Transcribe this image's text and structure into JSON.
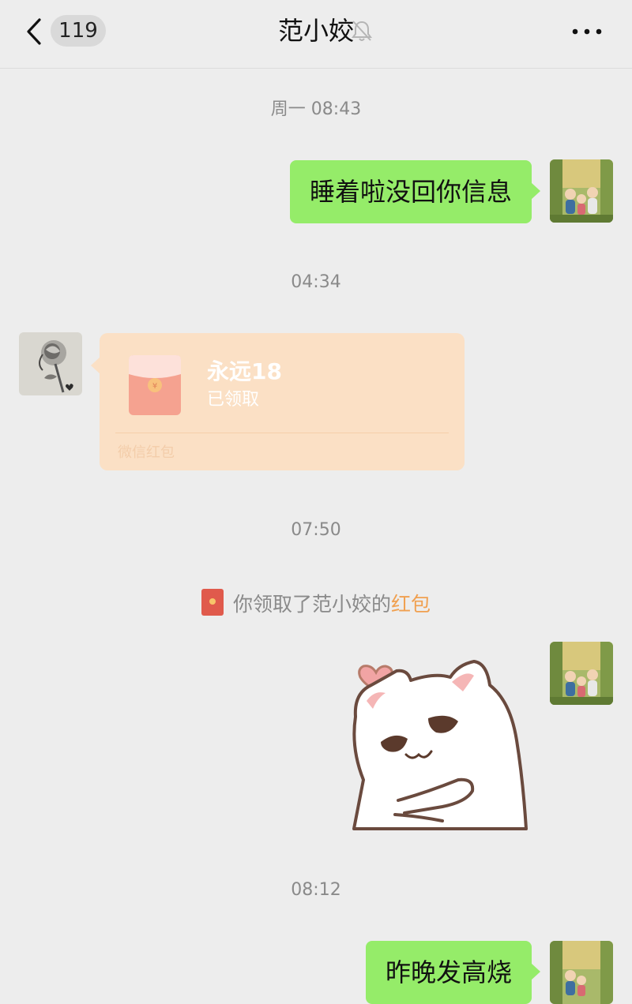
{
  "header": {
    "unread_count": "119",
    "title": "范小姣",
    "icons": [
      "back-chevron-icon",
      "mute-bell-icon",
      "more-dots-icon"
    ]
  },
  "messages": [
    {
      "type": "timestamp",
      "text": "周一 08:43"
    },
    {
      "type": "text",
      "side": "right",
      "text": "睡着啦没回你信息"
    },
    {
      "type": "timestamp",
      "text": "04:34"
    },
    {
      "type": "red_packet",
      "side": "left",
      "title": "永远18",
      "status": "已领取",
      "footer": "微信红包"
    },
    {
      "type": "timestamp",
      "text": "07:50"
    },
    {
      "type": "system",
      "prefix": "你领取了范小姣的",
      "link": "红包"
    },
    {
      "type": "sticker",
      "side": "right",
      "icon": "cat-hug-sticker"
    },
    {
      "type": "timestamp",
      "text": "08:12"
    },
    {
      "type": "text",
      "side": "right",
      "text": "昨晚发高烧"
    }
  ],
  "colors": {
    "background": "#ededed",
    "sent_bubble": "#95ec69",
    "red_packet_received": "#fbe0c5",
    "system_link": "#f0a050"
  }
}
